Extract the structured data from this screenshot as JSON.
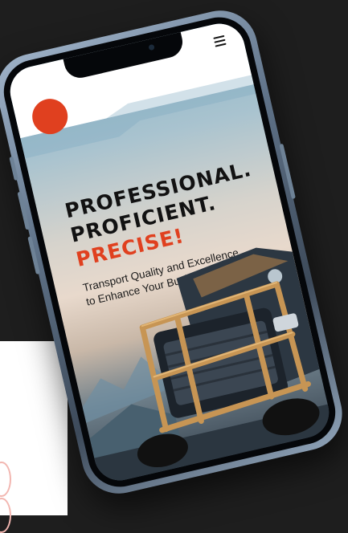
{
  "hero": {
    "line1": "PROFESSIONAL.",
    "line2": "PROFICIENT.",
    "line3": "PRECISE!",
    "subtitle_line1": "Transport Quality and Excellence",
    "subtitle_line2": "to Enhance Your Business"
  },
  "icons": {
    "menu": "hamburger-menu-icon",
    "logo": "logo-circle"
  },
  "colors": {
    "page_background": "#1e1e1e",
    "accent": "#e0401f",
    "headline": "#121212",
    "header": "#ffffff"
  }
}
